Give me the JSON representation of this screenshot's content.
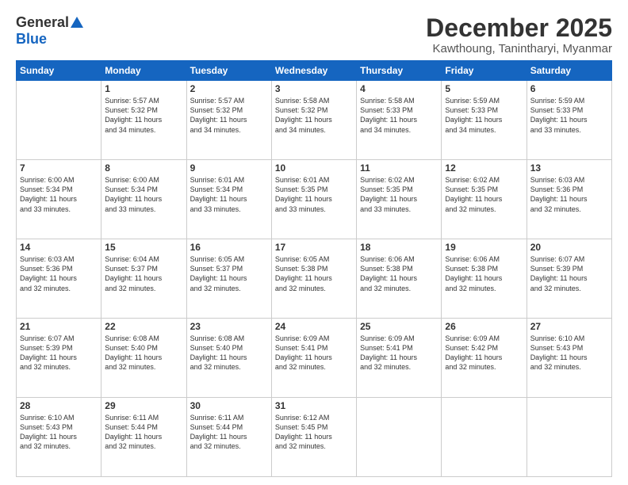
{
  "logo": {
    "general": "General",
    "blue": "Blue"
  },
  "header": {
    "month": "December 2025",
    "location": "Kawthoung, Tanintharyi, Myanmar"
  },
  "weekdays": [
    "Sunday",
    "Monday",
    "Tuesday",
    "Wednesday",
    "Thursday",
    "Friday",
    "Saturday"
  ],
  "weeks": [
    [
      {
        "day": "",
        "info": ""
      },
      {
        "day": "1",
        "info": "Sunrise: 5:57 AM\nSunset: 5:32 PM\nDaylight: 11 hours\nand 34 minutes."
      },
      {
        "day": "2",
        "info": "Sunrise: 5:57 AM\nSunset: 5:32 PM\nDaylight: 11 hours\nand 34 minutes."
      },
      {
        "day": "3",
        "info": "Sunrise: 5:58 AM\nSunset: 5:32 PM\nDaylight: 11 hours\nand 34 minutes."
      },
      {
        "day": "4",
        "info": "Sunrise: 5:58 AM\nSunset: 5:33 PM\nDaylight: 11 hours\nand 34 minutes."
      },
      {
        "day": "5",
        "info": "Sunrise: 5:59 AM\nSunset: 5:33 PM\nDaylight: 11 hours\nand 34 minutes."
      },
      {
        "day": "6",
        "info": "Sunrise: 5:59 AM\nSunset: 5:33 PM\nDaylight: 11 hours\nand 33 minutes."
      }
    ],
    [
      {
        "day": "7",
        "info": "Sunrise: 6:00 AM\nSunset: 5:34 PM\nDaylight: 11 hours\nand 33 minutes."
      },
      {
        "day": "8",
        "info": "Sunrise: 6:00 AM\nSunset: 5:34 PM\nDaylight: 11 hours\nand 33 minutes."
      },
      {
        "day": "9",
        "info": "Sunrise: 6:01 AM\nSunset: 5:34 PM\nDaylight: 11 hours\nand 33 minutes."
      },
      {
        "day": "10",
        "info": "Sunrise: 6:01 AM\nSunset: 5:35 PM\nDaylight: 11 hours\nand 33 minutes."
      },
      {
        "day": "11",
        "info": "Sunrise: 6:02 AM\nSunset: 5:35 PM\nDaylight: 11 hours\nand 33 minutes."
      },
      {
        "day": "12",
        "info": "Sunrise: 6:02 AM\nSunset: 5:35 PM\nDaylight: 11 hours\nand 32 minutes."
      },
      {
        "day": "13",
        "info": "Sunrise: 6:03 AM\nSunset: 5:36 PM\nDaylight: 11 hours\nand 32 minutes."
      }
    ],
    [
      {
        "day": "14",
        "info": "Sunrise: 6:03 AM\nSunset: 5:36 PM\nDaylight: 11 hours\nand 32 minutes."
      },
      {
        "day": "15",
        "info": "Sunrise: 6:04 AM\nSunset: 5:37 PM\nDaylight: 11 hours\nand 32 minutes."
      },
      {
        "day": "16",
        "info": "Sunrise: 6:05 AM\nSunset: 5:37 PM\nDaylight: 11 hours\nand 32 minutes."
      },
      {
        "day": "17",
        "info": "Sunrise: 6:05 AM\nSunset: 5:38 PM\nDaylight: 11 hours\nand 32 minutes."
      },
      {
        "day": "18",
        "info": "Sunrise: 6:06 AM\nSunset: 5:38 PM\nDaylight: 11 hours\nand 32 minutes."
      },
      {
        "day": "19",
        "info": "Sunrise: 6:06 AM\nSunset: 5:38 PM\nDaylight: 11 hours\nand 32 minutes."
      },
      {
        "day": "20",
        "info": "Sunrise: 6:07 AM\nSunset: 5:39 PM\nDaylight: 11 hours\nand 32 minutes."
      }
    ],
    [
      {
        "day": "21",
        "info": "Sunrise: 6:07 AM\nSunset: 5:39 PM\nDaylight: 11 hours\nand 32 minutes."
      },
      {
        "day": "22",
        "info": "Sunrise: 6:08 AM\nSunset: 5:40 PM\nDaylight: 11 hours\nand 32 minutes."
      },
      {
        "day": "23",
        "info": "Sunrise: 6:08 AM\nSunset: 5:40 PM\nDaylight: 11 hours\nand 32 minutes."
      },
      {
        "day": "24",
        "info": "Sunrise: 6:09 AM\nSunset: 5:41 PM\nDaylight: 11 hours\nand 32 minutes."
      },
      {
        "day": "25",
        "info": "Sunrise: 6:09 AM\nSunset: 5:41 PM\nDaylight: 11 hours\nand 32 minutes."
      },
      {
        "day": "26",
        "info": "Sunrise: 6:09 AM\nSunset: 5:42 PM\nDaylight: 11 hours\nand 32 minutes."
      },
      {
        "day": "27",
        "info": "Sunrise: 6:10 AM\nSunset: 5:43 PM\nDaylight: 11 hours\nand 32 minutes."
      }
    ],
    [
      {
        "day": "28",
        "info": "Sunrise: 6:10 AM\nSunset: 5:43 PM\nDaylight: 11 hours\nand 32 minutes."
      },
      {
        "day": "29",
        "info": "Sunrise: 6:11 AM\nSunset: 5:44 PM\nDaylight: 11 hours\nand 32 minutes."
      },
      {
        "day": "30",
        "info": "Sunrise: 6:11 AM\nSunset: 5:44 PM\nDaylight: 11 hours\nand 32 minutes."
      },
      {
        "day": "31",
        "info": "Sunrise: 6:12 AM\nSunset: 5:45 PM\nDaylight: 11 hours\nand 32 minutes."
      },
      {
        "day": "",
        "info": ""
      },
      {
        "day": "",
        "info": ""
      },
      {
        "day": "",
        "info": ""
      }
    ]
  ]
}
